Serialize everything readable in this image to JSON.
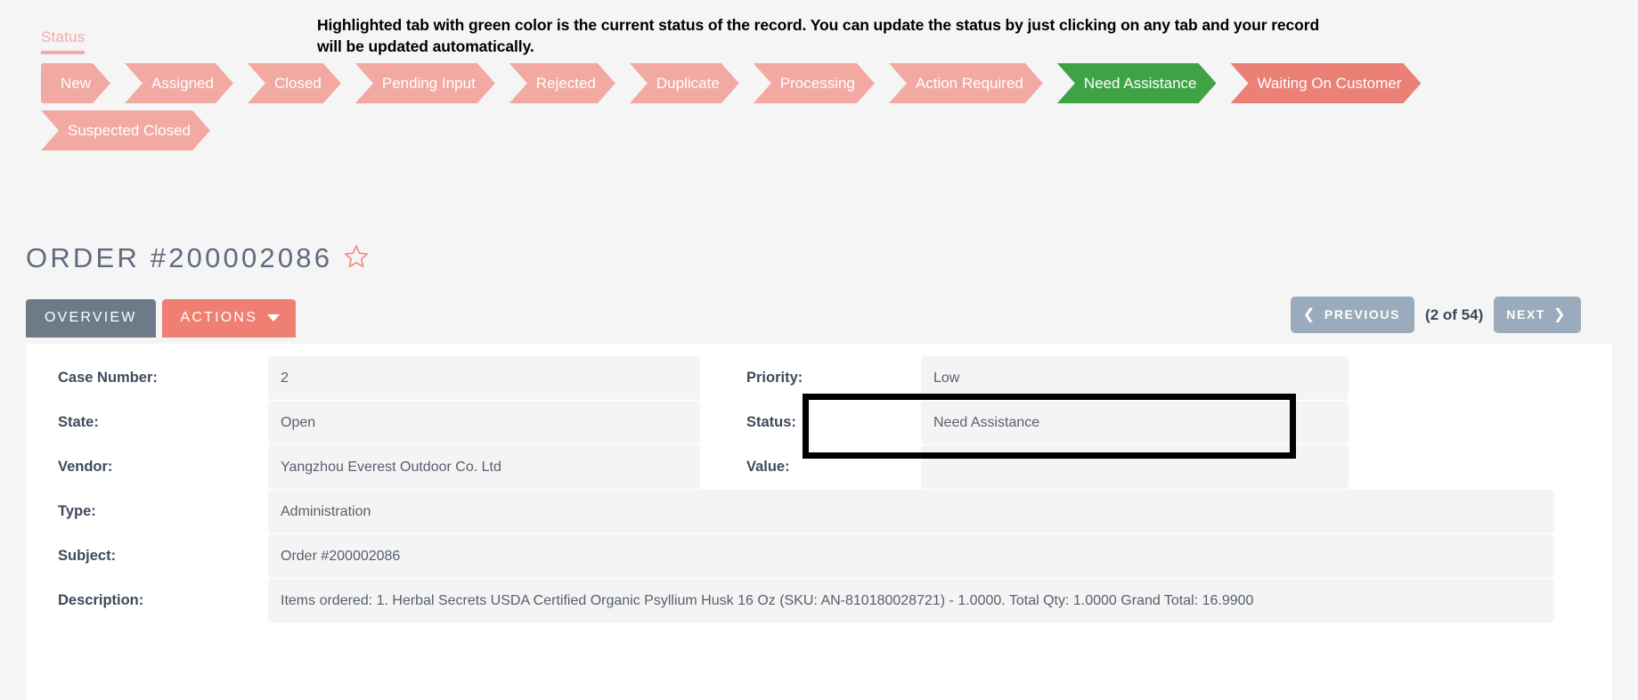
{
  "status_section": {
    "label": "Status",
    "annotation": "Highlighted tab with green color is the current status of the record. You can update the status by just clicking on any tab and your record will be updated automatically.",
    "colors": {
      "inactive": "#f2a9a2",
      "active": "#3fa346",
      "hovered": "#ea8076",
      "label": "#f4aaa6"
    },
    "tabs_row1": [
      {
        "label": "New",
        "state": "inactive"
      },
      {
        "label": "Assigned",
        "state": "inactive"
      },
      {
        "label": "Closed",
        "state": "inactive"
      },
      {
        "label": "Pending Input",
        "state": "inactive"
      },
      {
        "label": "Rejected",
        "state": "inactive"
      },
      {
        "label": "Duplicate",
        "state": "inactive"
      },
      {
        "label": "Processing",
        "state": "inactive"
      },
      {
        "label": "Action Required",
        "state": "inactive"
      },
      {
        "label": "Need Assistance",
        "state": "active"
      },
      {
        "label": "Waiting On Customer",
        "state": "hovered"
      }
    ],
    "tabs_row2": [
      {
        "label": "Suspected Closed",
        "state": "inactive"
      }
    ]
  },
  "header": {
    "title": "ORDER #200002086",
    "favorite_icon": "star-outline-icon",
    "favorite_color": "#ef8b80"
  },
  "toolbar": {
    "overview_label": "OVERVIEW",
    "actions_label": "ACTIONS",
    "caret_icon": "chevron-down-icon"
  },
  "pager": {
    "previous_label": "PREVIOUS",
    "next_label": "NEXT",
    "count_label": "(2 of 54)",
    "prev_icon": "chevron-left-icon",
    "next_icon": "chevron-right-icon"
  },
  "fields": {
    "case_number": {
      "label": "Case Number:",
      "value": "2"
    },
    "priority": {
      "label": "Priority:",
      "value": "Low"
    },
    "state": {
      "label": "State:",
      "value": "Open"
    },
    "status": {
      "label": "Status:",
      "value": "Need Assistance"
    },
    "vendor": {
      "label": "Vendor:",
      "value": "Yangzhou Everest Outdoor Co. Ltd"
    },
    "value": {
      "label": "Value:",
      "value": ""
    },
    "type": {
      "label": "Type:",
      "value": "Administration"
    },
    "subject": {
      "label": "Subject:",
      "value": "Order #200002086"
    },
    "description": {
      "label": "Description:",
      "value": "Items ordered: 1. Herbal Secrets USDA Certified Organic Psyllium Husk 16 Oz (SKU: AN-810180028721) - 1.0000. Total Qty: 1.0000 Grand Total: 16.9900"
    }
  }
}
